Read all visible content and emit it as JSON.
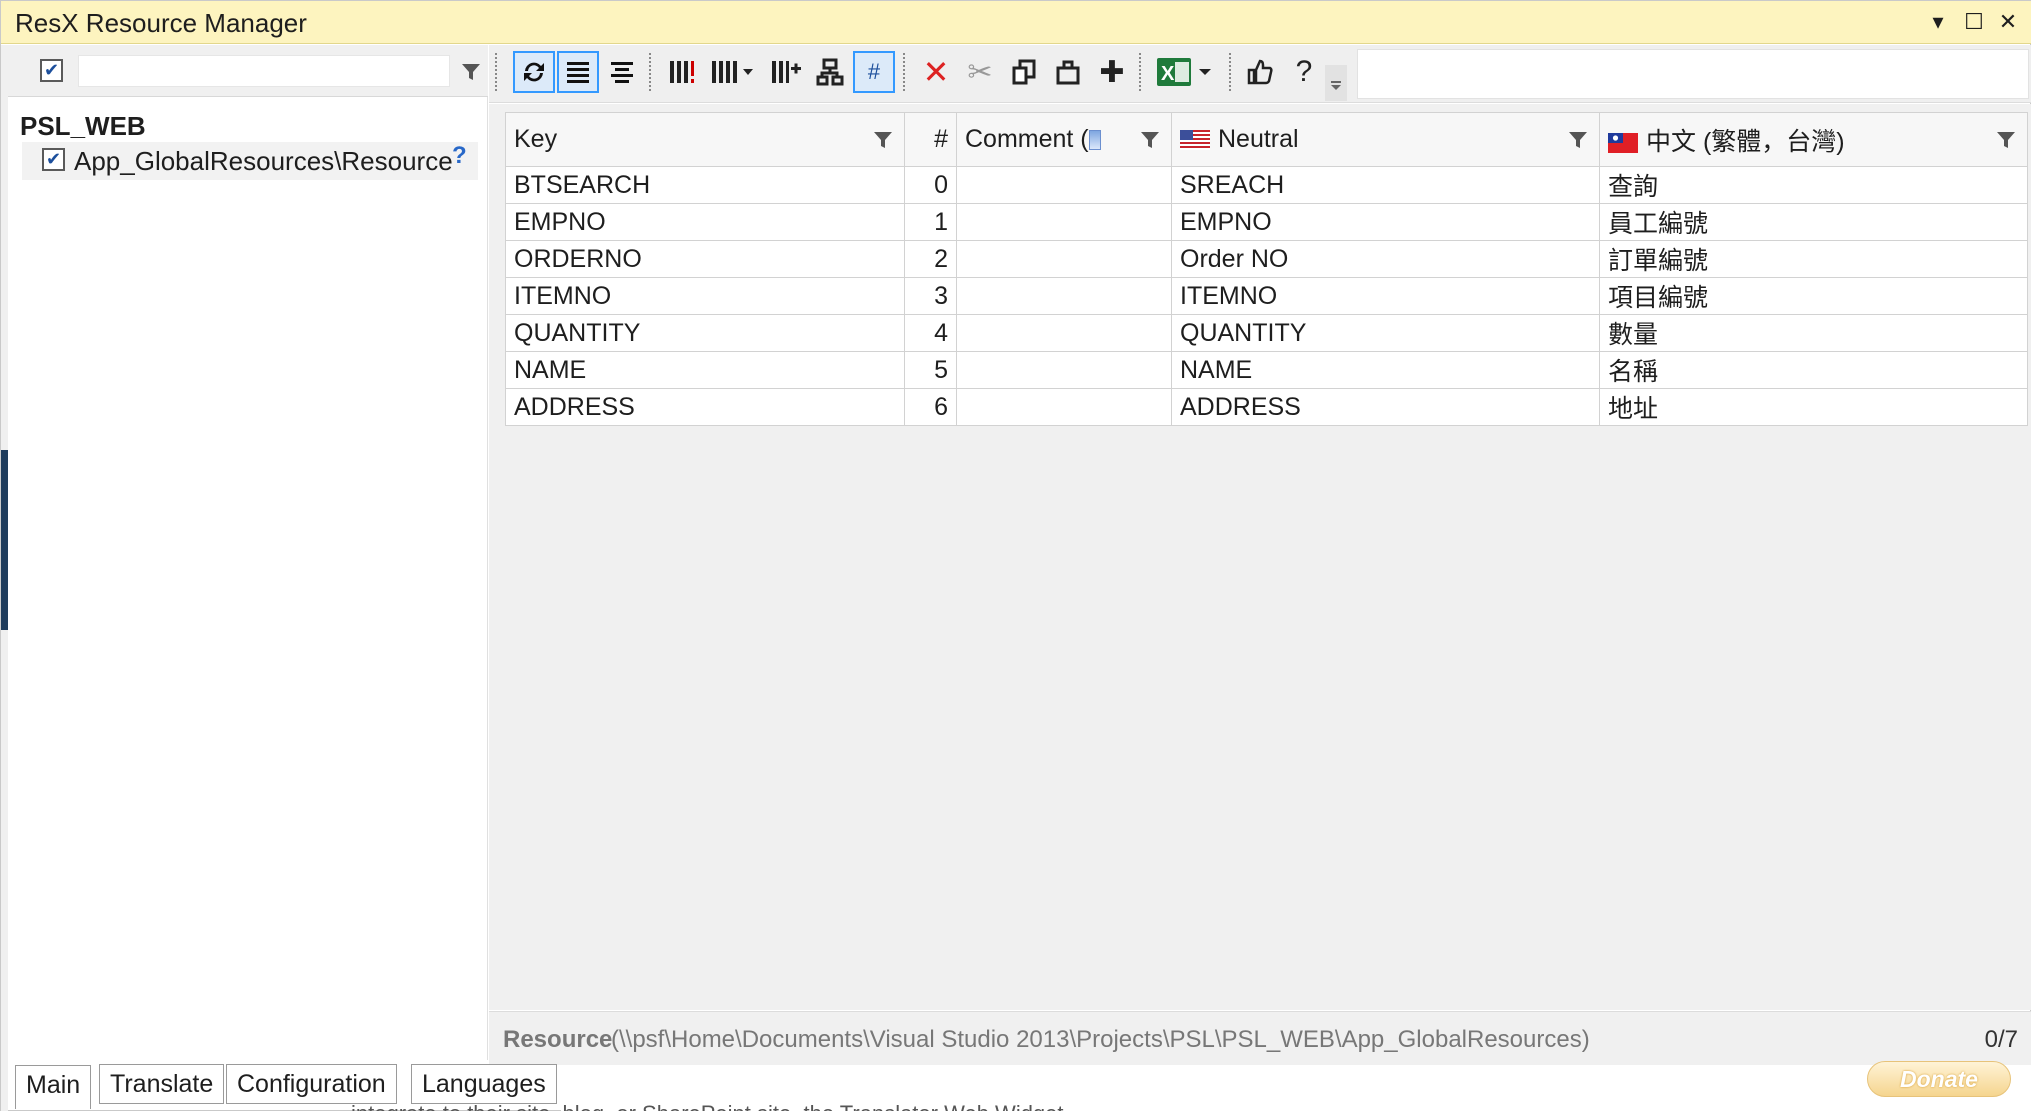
{
  "window": {
    "title": "ResX Resource Manager",
    "controls": [
      "▾",
      "☐",
      "✕"
    ]
  },
  "left_pane": {
    "filter_checkbox": "✔",
    "filter_value": "",
    "project": "PSL_WEB",
    "tree_item": {
      "checkbox": "✔",
      "label": "App_GlobalResources\\Resource",
      "help": "?"
    }
  },
  "toolbar": {
    "buttons": [
      {
        "icon": "refresh-icon",
        "glyph": "⟳"
      },
      {
        "icon": "align-justify-icon",
        "glyph": "≣"
      },
      {
        "icon": "align-center-icon",
        "glyph": "≡"
      },
      {
        "icon": "columns-warning-icon",
        "glyph": "⁞"
      },
      {
        "icon": "columns-dropdown-icon",
        "glyph": "⁞"
      },
      {
        "icon": "insert-column-icon",
        "glyph": "⁞"
      },
      {
        "icon": "hierarchy-icon",
        "glyph": "品"
      },
      {
        "icon": "hash-icon",
        "glyph": "#"
      },
      {
        "icon": "delete-icon",
        "glyph": "✕"
      },
      {
        "icon": "cut-icon",
        "glyph": "✂"
      },
      {
        "icon": "copy-icon",
        "glyph": "⧉"
      },
      {
        "icon": "paste-icon",
        "glyph": "⌂"
      },
      {
        "icon": "add-icon",
        "glyph": "✚"
      },
      {
        "icon": "excel-icon",
        "glyph": "X"
      },
      {
        "icon": "feedback-thumb-icon",
        "glyph": "👍"
      },
      {
        "icon": "help-icon",
        "glyph": "?"
      }
    ]
  },
  "grid": {
    "columns": [
      {
        "label": "Key"
      },
      {
        "label": "#"
      },
      {
        "label": "Comment ("
      },
      {
        "label": "Neutral"
      },
      {
        "label": "中文 (繁體，台灣)"
      }
    ],
    "rows": [
      {
        "key": "BTSEARCH",
        "index": "0",
        "comment": "",
        "neutral": "SREACH",
        "zh": "查詢"
      },
      {
        "key": "EMPNO",
        "index": "1",
        "comment": "",
        "neutral": "EMPNO",
        "zh": "員工編號"
      },
      {
        "key": "ORDERNO",
        "index": "2",
        "comment": "",
        "neutral": "Order NO",
        "zh": "訂單編號"
      },
      {
        "key": "ITEMNO",
        "index": "3",
        "comment": "",
        "neutral": "ITEMNO",
        "zh": "項目編號"
      },
      {
        "key": "QUANTITY",
        "index": "4",
        "comment": "",
        "neutral": "QUANTITY",
        "zh": "數量"
      },
      {
        "key": "NAME",
        "index": "5",
        "comment": "",
        "neutral": "NAME",
        "zh": "名稱"
      },
      {
        "key": "ADDRESS",
        "index": "6",
        "comment": "",
        "neutral": "ADDRESS",
        "zh": "地址"
      }
    ]
  },
  "status_bar": {
    "label": "Resource",
    "path": "(\\\\psf\\Home\\Documents\\Visual Studio 2013\\Projects\\PSL\\PSL_WEB\\App_GlobalResources)",
    "count": "0/7"
  },
  "tabs": [
    "Main",
    "Translate",
    "Configuration",
    "Languages"
  ],
  "donate": "Donate",
  "background_text": "integrate to their site, blog, or SharePoint site, the Translator Web Widget"
}
